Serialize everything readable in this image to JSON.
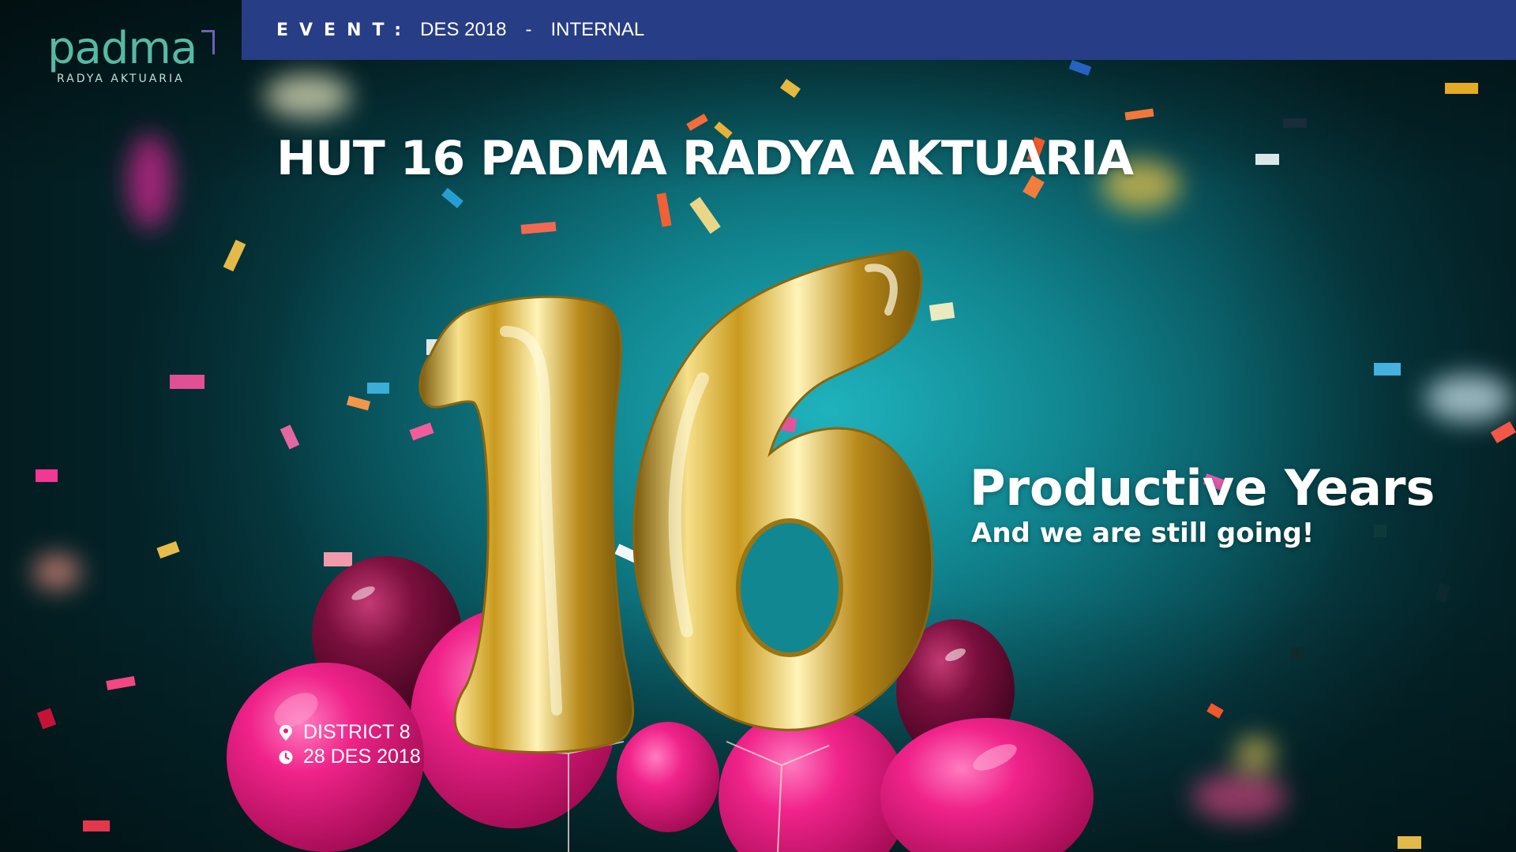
{
  "brand": {
    "name": "padma",
    "subtitle": "RADYA AKTUARIA",
    "color": "#57b9a3"
  },
  "topbar": {
    "label": "EVENT:",
    "date": "DES 2018",
    "separator": "-",
    "type": "INTERNAL",
    "color": "#273d85"
  },
  "headline": "HUT 16 PADMA RADYA AKTUARIA",
  "tagline": {
    "main": "Productive Years",
    "sub": "And we are still going!"
  },
  "details": {
    "location": "DISTRICT 8",
    "date": "28 DES 2018",
    "location_icon": "map-pin-icon",
    "date_icon": "clock-icon"
  },
  "artwork": {
    "number": "16",
    "balloon_gold": "#d8b43a",
    "balloon_pink": "#e8197c",
    "balloon_maroon": "#7a0f3d"
  }
}
